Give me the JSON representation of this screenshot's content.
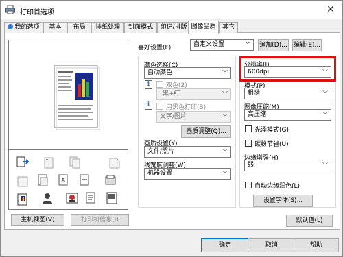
{
  "window": {
    "title": "打印首选项",
    "close_glyph": "✕"
  },
  "tabs": [
    {
      "label": "我的选项"
    },
    {
      "label": "基本"
    },
    {
      "label": "布局"
    },
    {
      "label": "排纸处理"
    },
    {
      "label": "封面模式"
    },
    {
      "label": "印记/排版"
    },
    {
      "label": "图像品质"
    },
    {
      "label": "其它"
    }
  ],
  "favorite": {
    "label": "喜好设置(F)",
    "value": "自定义设置",
    "add_button": "追加(D)...",
    "edit_button": "编辑(E)..."
  },
  "color_select": {
    "label": "颜色选择(C)",
    "value": "自动颜色"
  },
  "dual_color": {
    "label": "双色(2)",
    "value": "黑+红"
  },
  "black_print": {
    "label": "用黑色打印(B)",
    "value": "文字/图片"
  },
  "quality_adjust_button": "画质调整(Q)...",
  "quality_setting": {
    "label": "画质设置(Y)",
    "value": "文件/照片"
  },
  "line_width": {
    "label": "线宽度调整(W)",
    "value": "机器设置"
  },
  "resolution": {
    "label": "分辨率(I)",
    "value": "600dpi"
  },
  "pattern": {
    "label": "模式(P)",
    "value": "粗糙"
  },
  "compression": {
    "label": "图像压缩(M)",
    "value": "高压缩"
  },
  "glossy": {
    "label": "光泽模式(G)"
  },
  "toner_save": {
    "label": "碳粉节省(U)"
  },
  "edge_enhance": {
    "label": "边缘增强(H)",
    "value": "弱"
  },
  "auto_trap": {
    "label": "自动边缘润色(L)"
  },
  "font_settings_button": "设置字体(S)...",
  "default_button": "默认值(L)",
  "main_view_button": "主机视图(V)",
  "printer_info_button": "打印机信息(I)",
  "footer": {
    "ok": "确定",
    "cancel": "取消",
    "help": "帮助"
  },
  "colors": {
    "highlight": "#e01010",
    "accent": "#0078d7"
  }
}
